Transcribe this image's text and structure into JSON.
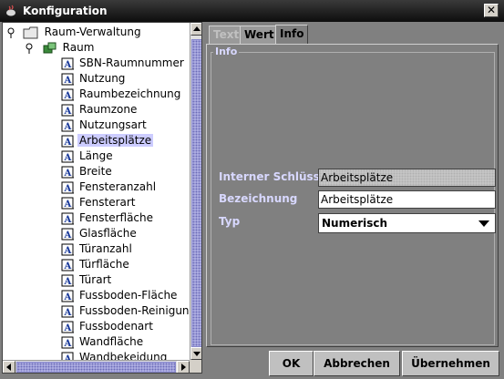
{
  "window": {
    "title": "Konfiguration",
    "close_label": "✕"
  },
  "tree": {
    "root": "Raum-Verwaltung",
    "child": "Raum",
    "items": [
      "SBN-Raumnummer",
      "Nutzung",
      "Raumbezeichnung",
      "Raumzone",
      "Nutzungsart",
      "Arbeitsplätze",
      "Länge",
      "Breite",
      "Fensteranzahl",
      "Fensterart",
      "Fensterfläche",
      "Glasfläche",
      "Türanzahl",
      "Türfläche",
      "Türart",
      "Fussboden-Fläche",
      "Fussboden-Reinigung",
      "Fussbodenart",
      "Wandfläche",
      "Wandbekeidung"
    ],
    "selected_index": 5
  },
  "tabs": [
    {
      "label": "Text",
      "state": "disabled"
    },
    {
      "label": "Wert",
      "state": "normal"
    },
    {
      "label": "Info",
      "state": "active"
    }
  ],
  "info": {
    "group_title": "Info",
    "internal_key_label": "Interner Schlüssel",
    "internal_key_value": "Arbeitsplätze",
    "name_label": "Bezeichnung",
    "name_value": "Arbeitsplätze",
    "type_label": "Typ",
    "type_value": "Numerisch"
  },
  "buttons": {
    "ok": "OK",
    "cancel": "Abbrechen",
    "apply": "Übernehmen"
  }
}
